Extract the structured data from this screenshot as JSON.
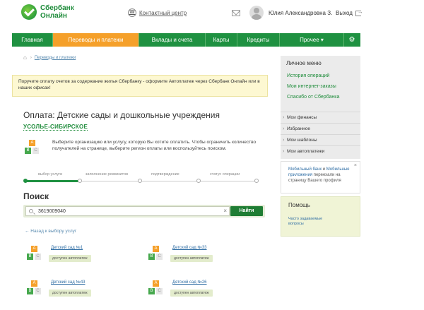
{
  "header": {
    "logo_line1": "Сбербанк",
    "logo_line2": "Онлайн",
    "contact_label": "Контактный центр",
    "user_name": "Юлия Александровна З.",
    "logout_label": "Выход"
  },
  "nav": {
    "items": [
      {
        "label": "Главная"
      },
      {
        "label": "Переводы и платежи"
      },
      {
        "label": "Вклады и счета"
      },
      {
        "label": "Карты"
      },
      {
        "label": "Кредиты"
      },
      {
        "label": "Прочее ▾"
      }
    ],
    "active_color": "#f5a02a",
    "bar_color": "#1f9141"
  },
  "breadcrumb": {
    "separator": "›",
    "current": "Переводы и платежи"
  },
  "notice": {
    "text": "Поручите оплату счетов за содержание жилья Сбербанку - оформите Автоплатеж через Сбербанк Онлайн или в наших офисах!"
  },
  "page": {
    "title": "Оплата: Детские сады и дошкольные учреждения",
    "region": "УСОЛЬЕ-СИБИРСКОЕ",
    "hint": "Выберите организацию или услугу, которую Вы хотите оплатить. Чтобы ограничить количество получателей на странице, выберите регион оплаты или воспользуйтесь поиском."
  },
  "steps": [
    {
      "label": "выбор услуги",
      "active": true
    },
    {
      "label": "заполнение реквизитов",
      "active": false
    },
    {
      "label": "подтверждение",
      "active": false
    },
    {
      "label": "статус операции",
      "active": false
    }
  ],
  "search": {
    "title": "Поиск",
    "value": "3619009040",
    "clear_icon": "×",
    "button_label": "Найти",
    "back_link": "← Назад к выбору услуг"
  },
  "results": [
    {
      "title": "Детский сад №1",
      "badge": "доступен автоплатеж"
    },
    {
      "title": "Детский сад №33",
      "badge": "доступен автоплатеж"
    },
    {
      "title": "Детский сад №43",
      "badge": "доступен автоплатеж"
    },
    {
      "title": "Детский сад №26",
      "badge": "доступен автоплатеж"
    }
  ],
  "abc_icon": {
    "a": "A",
    "b": "B",
    "c": "C"
  },
  "sidebar": {
    "heading": "Личное меню",
    "links": [
      "История операций",
      "Мои интернет-заказы",
      "Спасибо от Сбербанка"
    ],
    "rows": [
      "Мои финансы",
      "Избранное",
      "Мои шаблоны",
      "Мои автоплатежи"
    ],
    "promo_link1": "Мобильный банк",
    "promo_and": " и ",
    "promo_link2": "Мобильные приложения",
    "promo_text": " переехали на страницу Вашего профиля",
    "promo_close": "×",
    "help_heading": "Помощь",
    "help_link": "Часто задаваемые вопросы"
  }
}
